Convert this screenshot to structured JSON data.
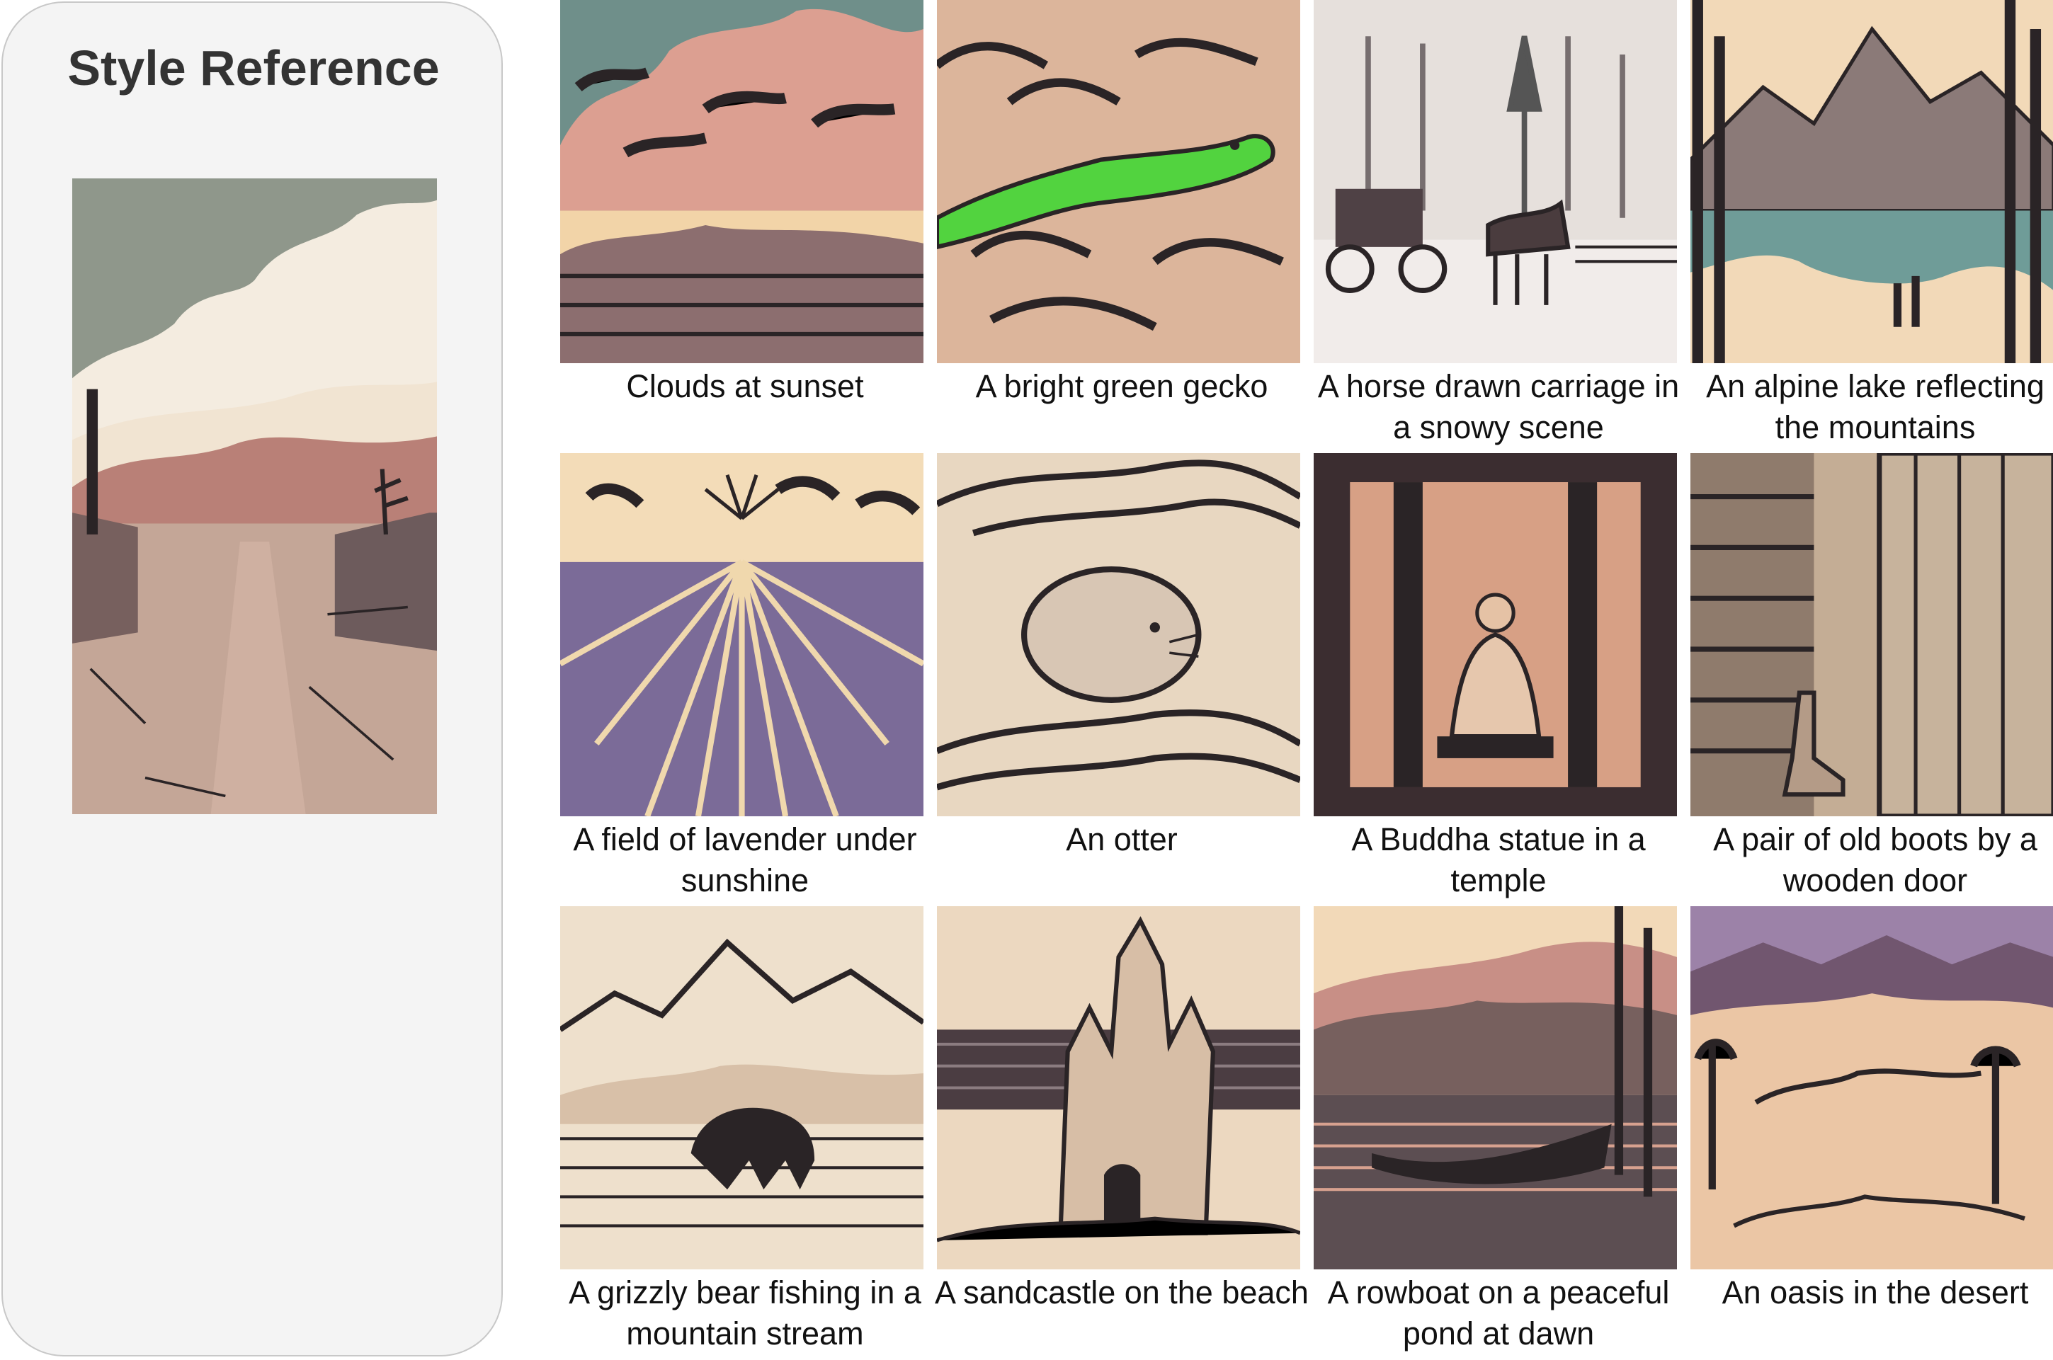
{
  "style_reference": {
    "title": "Style Reference"
  },
  "gallery": {
    "items": [
      {
        "caption": "Clouds at sunset"
      },
      {
        "caption": "A bright green gecko"
      },
      {
        "caption": "A horse drawn carriage in a snowy scene"
      },
      {
        "caption": "An alpine lake reflecting the mountains"
      },
      {
        "caption": "A field of lavender under sunshine"
      },
      {
        "caption": "An otter"
      },
      {
        "caption": "A Buddha statue in a temple"
      },
      {
        "caption": "A pair of old boots by a wooden door"
      },
      {
        "caption": "A grizzly bear fishing in a mountain stream"
      },
      {
        "caption": "A sandcastle on the beach"
      },
      {
        "caption": "A rowboat on a peaceful pond at dawn"
      },
      {
        "caption": "An oasis in the desert"
      }
    ]
  },
  "colors": {
    "panel_background": "#f4f4f4",
    "panel_border": "#c8c8c8",
    "ink": "#2a2426",
    "paper": "#ead5bf",
    "dusty_pink": "#c88f86",
    "sage_sky": "#8f978b",
    "lavender": "#7b6b98",
    "teal": "#6f9c98",
    "gecko_green": "#52d33f"
  }
}
